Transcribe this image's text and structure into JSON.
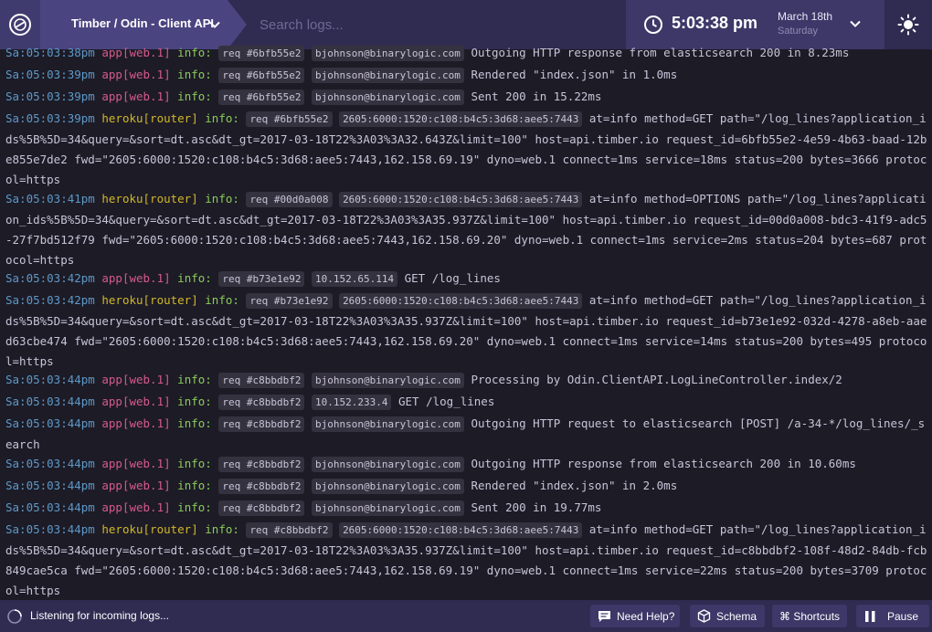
{
  "header": {
    "logo_icon": "timber-logo-icon",
    "breadcrumb": "Timber / Odin - Client API",
    "search_placeholder": "Search logs...",
    "time": "5:03:38 pm",
    "date": "March 18th",
    "day": "Saturday",
    "theme_icon": "sun-icon"
  },
  "log_lines": [
    {
      "ts": "Sa:05:03:38pm",
      "src": "app[web.1]",
      "type": "app",
      "lvl": "info:",
      "tags": [
        "req #6bfb55e2",
        "bjohnson@binarylogic.com"
      ],
      "msg": "Outgoing HTTP response from elasticsearch 200 in 8.23ms"
    },
    {
      "ts": "Sa:05:03:39pm",
      "src": "app[web.1]",
      "type": "app",
      "lvl": "info:",
      "tags": [
        "req #6bfb55e2",
        "bjohnson@binarylogic.com"
      ],
      "msg": "Rendered \"index.json\" in 1.0ms"
    },
    {
      "ts": "Sa:05:03:39pm",
      "src": "app[web.1]",
      "type": "app",
      "lvl": "info:",
      "tags": [
        "req #6bfb55e2",
        "bjohnson@binarylogic.com"
      ],
      "msg": "Sent 200 in 15.22ms"
    },
    {
      "ts": "Sa:05:03:39pm",
      "src": "heroku[router]",
      "type": "heroku",
      "lvl": "info:",
      "tags": [
        "req #6bfb55e2",
        "2605:6000:1520:c108:b4c5:3d68:aee5:7443"
      ],
      "msg": "at=info method=GET path=\"/log_lines?application_ids%5B%5D=34&query=&sort=dt.asc&dt_gt=2017-03-18T22%3A03%3A32.643Z&limit=100\" host=api.timber.io request_id=6bfb55e2-4e59-4b63-baad-12be855e7de2 fwd=\"2605:6000:1520:c108:b4c5:3d68:aee5:7443,162.158.69.19\" dyno=web.1 connect=1ms service=18ms status=200 bytes=3666 protocol=https"
    },
    {
      "ts": "Sa:05:03:41pm",
      "src": "heroku[router]",
      "type": "heroku",
      "lvl": "info:",
      "tags": [
        "req #00d0a008",
        "2605:6000:1520:c108:b4c5:3d68:aee5:7443"
      ],
      "msg": "at=info method=OPTIONS path=\"/log_lines?application_ids%5B%5D=34&query=&sort=dt.asc&dt_gt=2017-03-18T22%3A03%3A35.937Z&limit=100\" host=api.timber.io request_id=00d0a008-bdc3-41f9-adc5-27f7bd512f79 fwd=\"2605:6000:1520:c108:b4c5:3d68:aee5:7443,162.158.69.20\" dyno=web.1 connect=1ms service=2ms status=204 bytes=687 protocol=https"
    },
    {
      "ts": "Sa:05:03:42pm",
      "src": "app[web.1]",
      "type": "app",
      "lvl": "info:",
      "tags": [
        "req #b73e1e92",
        "10.152.65.114"
      ],
      "msg": "GET /log_lines"
    },
    {
      "ts": "Sa:05:03:42pm",
      "src": "heroku[router]",
      "type": "heroku",
      "lvl": "info:",
      "tags": [
        "req #b73e1e92",
        "2605:6000:1520:c108:b4c5:3d68:aee5:7443"
      ],
      "msg": "at=info method=GET path=\"/log_lines?application_ids%5B%5D=34&query=&sort=dt.asc&dt_gt=2017-03-18T22%3A03%3A35.937Z&limit=100\" host=api.timber.io request_id=b73e1e92-032d-4278-a8eb-aaed63cbe474 fwd=\"2605:6000:1520:c108:b4c5:3d68:aee5:7443,162.158.69.20\" dyno=web.1 connect=1ms service=14ms status=200 bytes=495 protocol=https"
    },
    {
      "ts": "Sa:05:03:44pm",
      "src": "app[web.1]",
      "type": "app",
      "lvl": "info:",
      "tags": [
        "req #c8bbdbf2",
        "bjohnson@binarylogic.com"
      ],
      "msg": "Processing by Odin.ClientAPI.LogLineController.index/2"
    },
    {
      "ts": "Sa:05:03:44pm",
      "src": "app[web.1]",
      "type": "app",
      "lvl": "info:",
      "tags": [
        "req #c8bbdbf2",
        "10.152.233.4"
      ],
      "msg": "GET /log_lines"
    },
    {
      "ts": "Sa:05:03:44pm",
      "src": "app[web.1]",
      "type": "app",
      "lvl": "info:",
      "tags": [
        "req #c8bbdbf2",
        "bjohnson@binarylogic.com"
      ],
      "msg": "Outgoing HTTP request to elasticsearch [POST] /a-34-*/log_lines/_search"
    },
    {
      "ts": "Sa:05:03:44pm",
      "src": "app[web.1]",
      "type": "app",
      "lvl": "info:",
      "tags": [
        "req #c8bbdbf2",
        "bjohnson@binarylogic.com"
      ],
      "msg": "Outgoing HTTP response from elasticsearch 200 in 10.60ms"
    },
    {
      "ts": "Sa:05:03:44pm",
      "src": "app[web.1]",
      "type": "app",
      "lvl": "info:",
      "tags": [
        "req #c8bbdbf2",
        "bjohnson@binarylogic.com"
      ],
      "msg": "Rendered \"index.json\" in 2.0ms"
    },
    {
      "ts": "Sa:05:03:44pm",
      "src": "app[web.1]",
      "type": "app",
      "lvl": "info:",
      "tags": [
        "req #c8bbdbf2",
        "bjohnson@binarylogic.com"
      ],
      "msg": "Sent 200 in 19.77ms"
    },
    {
      "ts": "Sa:05:03:44pm",
      "src": "heroku[router]",
      "type": "heroku",
      "lvl": "info:",
      "tags": [
        "req #c8bbdbf2",
        "2605:6000:1520:c108:b4c5:3d68:aee5:7443"
      ],
      "msg": "at=info method=GET path=\"/log_lines?application_ids%5B%5D=34&query=&sort=dt.asc&dt_gt=2017-03-18T22%3A03%3A35.937Z&limit=100\" host=api.timber.io request_id=c8bbdbf2-108f-48d2-84db-fcb849cae5ca fwd=\"2605:6000:1520:c108:b4c5:3d68:aee5:7443,162.158.69.19\" dyno=web.1 connect=1ms service=22ms status=200 bytes=3709 protocol=https"
    }
  ],
  "footer": {
    "status": "Listening for incoming logs...",
    "help_label": "Need Help?",
    "schema_label": "Schema",
    "shortcuts_label": "⌘ Shortcuts",
    "pause_label": "Pause"
  },
  "colors": {
    "topbar": "#2f2b51",
    "breadcrumb_bg": "#4a4480",
    "log_bg": "#1d1b26",
    "timestamp": "#5d99c8",
    "source_app": "#d65a8d",
    "source_heroku": "#d0b82a",
    "level_info": "#8acc5a"
  }
}
